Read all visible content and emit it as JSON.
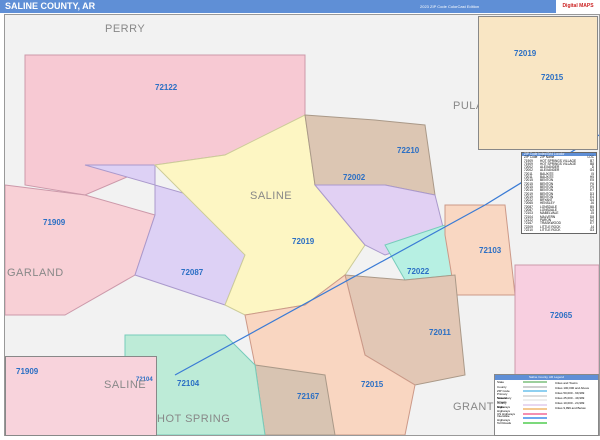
{
  "header": {
    "title": "SALINE COUNTY, AR",
    "edition": "2023 ZIP Code ColorCast Edition",
    "logo": "Digital MAPS"
  },
  "counties": [
    "PERRY",
    "PULASKI",
    "SALINE",
    "GARLAND",
    "HOT SPRING",
    "GRANT"
  ],
  "zips": [
    {
      "code": "72122",
      "color": "#f7c9d3"
    },
    {
      "code": "72210",
      "color": "#dcc6b3"
    },
    {
      "code": "72002",
      "color": "#e1d0f3"
    },
    {
      "code": "71909",
      "color": "#f8d0d6"
    },
    {
      "code": "72019",
      "color": "#fdf6c3"
    },
    {
      "code": "72087",
      "color": "#ddd1f5"
    },
    {
      "code": "72022",
      "color": "#b7f0e3"
    },
    {
      "code": "72103",
      "color": "#f9d7c2"
    },
    {
      "code": "72011",
      "color": "#e2c7b5"
    },
    {
      "code": "72065",
      "color": "#f8cfe0"
    },
    {
      "code": "72104",
      "color": "#bdebd7"
    },
    {
      "code": "72167",
      "color": "#d8c4b2"
    },
    {
      "code": "72015",
      "color": "#f9d6c1"
    }
  ],
  "inset_top": {
    "zips": [
      "72019",
      "72015"
    ]
  },
  "inset_bottom": {
    "zips": [
      "71909",
      "72104"
    ],
    "counties": [
      "SALINE",
      "HOT SPRING"
    ]
  },
  "index_table": {
    "title": "ZIP Code Index/Grid Locator",
    "headers": [
      "ZIP Code",
      "ZIP Name",
      "LOC"
    ],
    "rows": [
      [
        "71909",
        "HOT SPRINGS VILLAGE",
        "B7"
      ],
      [
        "71909",
        "HOT SPRINGS VILLAGE",
        "B8"
      ],
      [
        "72002",
        "ALEXANDER",
        "D"
      ],
      [
        "72002",
        "ALEXANDER",
        "G4"
      ],
      [
        "72011",
        "BAUXITE",
        "I5"
      ],
      [
        "72011",
        "BAUXITE",
        "H5"
      ],
      [
        "72015",
        "BENTON",
        "E5"
      ],
      [
        "72015",
        "BENTON",
        "F6"
      ],
      [
        "72015",
        "BENTON",
        "F5"
      ],
      [
        "72015",
        "BENTON",
        "E7"
      ],
      [
        "72019",
        "BENTON",
        "D3"
      ],
      [
        "72019",
        "BENTON",
        "E4"
      ],
      [
        "72022",
        "BRYANT",
        "G4"
      ],
      [
        "72065",
        "HENSLEY",
        "J6"
      ],
      [
        "72087",
        "LONSDALE",
        "B5"
      ],
      [
        "72087",
        "LONSDALE",
        "C5"
      ],
      [
        "72103",
        "MABELVALE",
        "J5"
      ],
      [
        "72104",
        "MALVERN",
        "D8"
      ],
      [
        "72122",
        "PARON",
        "C2"
      ],
      [
        "72167",
        "TRASKWOOD",
        "E7"
      ],
      [
        "72209",
        "LITTLE ROCK",
        "J4"
      ],
      [
        "72210",
        "LITTLE ROCK",
        "G3"
      ]
    ]
  },
  "legend": {
    "title": "Saline County, AR Legend",
    "items": [
      "State",
      "County",
      "ZIP Code",
      "Primary Streets",
      "Secondary Streets",
      "County Highways",
      "State Highways",
      "US Highways",
      "Interstate Highways",
      "Toll Roads"
    ],
    "colors": [
      "#9ccf9c",
      "#cfcfcf",
      "#8fd0f0",
      "#dddddd",
      "#eeeeee",
      "#e8d8f0",
      "#f4c890",
      "#f48fb1",
      "#6fa8f0",
      "#7cd97c"
    ],
    "right": [
      "Cities and Towns",
      "Cities 100,000 and Above",
      "Cities 50,000 - 99,999",
      "Cities 25,000 - 49,999",
      "Cities 10,000 - 24,999",
      "Cities 9,999 and Below"
    ]
  }
}
